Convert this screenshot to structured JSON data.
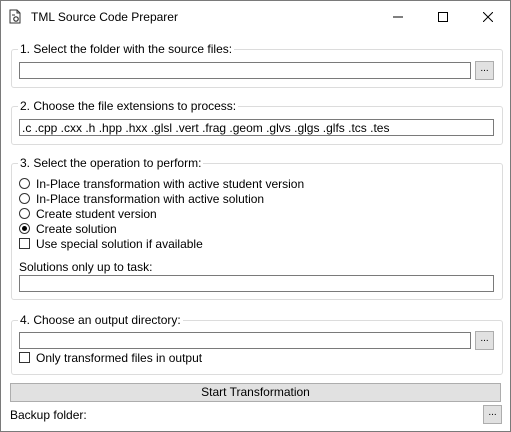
{
  "window": {
    "title": "TML Source Code Preparer"
  },
  "icons": {
    "app": "document-gear-icon",
    "minimize": "minimize-icon",
    "maximize": "maximize-icon",
    "close": "close-icon"
  },
  "section1": {
    "label": "1. Select the folder with the source files:",
    "folder_value": "",
    "browse_label": "..."
  },
  "section2": {
    "label": "2. Choose the file extensions to process:",
    "extensions_value": ".c .cpp .cxx .h .hpp .hxx .glsl .vert .frag .geom .glvs .glgs .glfs .tcs .tes"
  },
  "section3": {
    "label": "3. Select the operation to perform:",
    "options": [
      {
        "label": "In-Place transformation with active student version",
        "selected": false
      },
      {
        "label": "In-Place transformation with active solution",
        "selected": false
      },
      {
        "label": "Create student version",
        "selected": false
      },
      {
        "label": "Create solution",
        "selected": true
      }
    ],
    "special_solution_label": "Use special solution if available",
    "special_solution_checked": false,
    "solutions_up_to_label": "Solutions only up to task:",
    "solutions_up_to_value": ""
  },
  "section4": {
    "label": "4. Choose an output directory:",
    "output_value": "",
    "browse_label": "...",
    "only_transformed_label": "Only transformed files in output",
    "only_transformed_checked": false
  },
  "start_button_label": "Start Transformation",
  "backup": {
    "label": "Backup folder:",
    "browse_label": "..."
  }
}
